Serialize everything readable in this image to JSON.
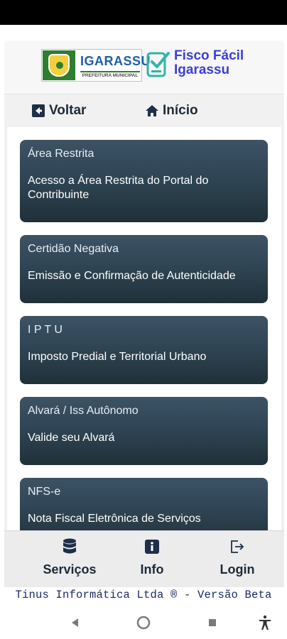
{
  "header": {
    "logo_name": "IGARASSU",
    "logo_subtitle": "PREFEITURA MUNICIPAL",
    "app_title_line1": "Fisco Fácil",
    "app_title_line2": "Igarassu"
  },
  "nav": {
    "back_label": "Voltar",
    "home_label": "Início"
  },
  "cards": [
    {
      "title": "Área Restrita",
      "description": "Acesso a Área Restrita do Portal do Contribuinte"
    },
    {
      "title": "Certidão Negativa",
      "description": "Emissão e Confirmação de Autenticidade"
    },
    {
      "title": "I P T U",
      "description": "Imposto Predial e Territorial Urbano"
    },
    {
      "title": "Alvará / Iss Autônomo",
      "description": "Valide seu Alvará"
    },
    {
      "title": "NFS-e",
      "description": "Nota Fiscal Eletrônica de Serviços"
    }
  ],
  "bottom_nav": {
    "servicos": "Serviços",
    "info": "Info",
    "login": "Login"
  },
  "footer": {
    "note": "Tinus Informática Ltda ® - Versão Beta"
  },
  "icons": {
    "back": "arrow-left-box-icon",
    "home": "home-icon",
    "servicos": "database-icon",
    "info": "info-icon",
    "login": "sign-out-icon",
    "sys_back": "triangle-back-icon",
    "sys_home": "circle-home-icon",
    "sys_recents": "square-recents-icon",
    "sys_accessibility": "accessibility-icon"
  },
  "colors": {
    "card_gradient_top": "#3c5366",
    "card_gradient_bottom": "#1f3038",
    "brand_blue": "#3b3fd8",
    "text_dark": "#1e2a38",
    "footer_text": "#1a2a66"
  }
}
